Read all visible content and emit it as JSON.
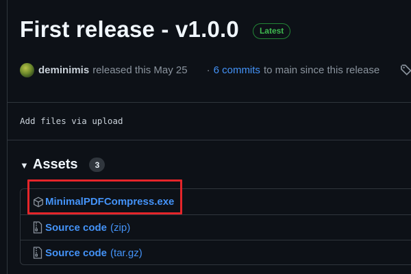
{
  "release": {
    "title": "First release - v1.0.0",
    "latest_badge": "Latest"
  },
  "meta": {
    "username": "deminimis",
    "released_text": "released this May 25",
    "separator": "·",
    "commits_link": "6 commits",
    "commits_suffix": "to main since this release"
  },
  "description": "Add files via upload",
  "assets": {
    "title": "Assets",
    "count": "3",
    "items": [
      {
        "name": "MinimalPDFCompress.exe",
        "suffix": "",
        "icon": "package-icon"
      },
      {
        "name": "Source code",
        "suffix": "(zip)",
        "icon": "file-zip-icon"
      },
      {
        "name": "Source code",
        "suffix": "(tar.gz)",
        "icon": "file-zip-icon"
      }
    ]
  },
  "colors": {
    "background": "#0d1117",
    "link": "#4493f8",
    "latest_green": "#3fb950",
    "highlight": "#e5252a"
  }
}
